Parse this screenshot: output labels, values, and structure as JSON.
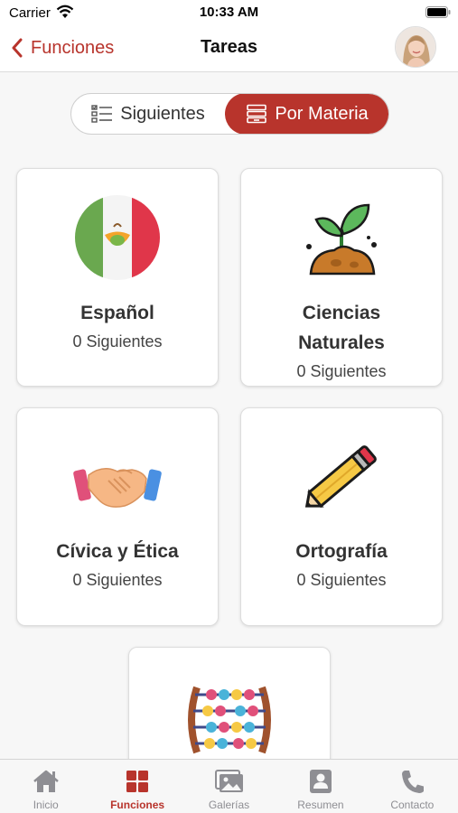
{
  "status_bar": {
    "carrier": "Carrier",
    "time": "10:33 AM"
  },
  "nav": {
    "back_label": "Funciones",
    "title": "Tareas"
  },
  "segmented": {
    "left_label": "Siguientes",
    "right_label": "Por Materia",
    "selected": "Por Materia"
  },
  "subjects": [
    {
      "title": "Español",
      "subtitle": "0 Siguientes",
      "icon": "mexico-flag-icon"
    },
    {
      "title": "Ciencias Naturales",
      "subtitle": "0 Siguientes",
      "icon": "sprout-icon"
    },
    {
      "title": "Cívica y Ética",
      "subtitle": "0 Siguientes",
      "icon": "handshake-icon"
    },
    {
      "title": "Ortografía",
      "subtitle": "0 Siguientes",
      "icon": "pencil-icon"
    },
    {
      "title": "",
      "subtitle": "",
      "icon": "abacus-icon"
    }
  ],
  "tabs": [
    {
      "label": "Inicio",
      "icon": "home-icon"
    },
    {
      "label": "Funciones",
      "icon": "grid-icon",
      "active": true
    },
    {
      "label": "Galerías",
      "icon": "gallery-icon"
    },
    {
      "label": "Resumen",
      "icon": "profile-card-icon"
    },
    {
      "label": "Contacto",
      "icon": "phone-icon"
    }
  ],
  "colors": {
    "accent": "#b8342c",
    "inactive_tab": "#8e8e93",
    "background": "#f7f7f7"
  }
}
